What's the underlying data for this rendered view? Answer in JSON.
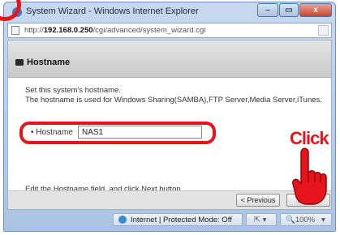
{
  "window": {
    "title": "System Wizard - Windows Internet Explorer",
    "title_icon": "ie-icon",
    "controls": {
      "minimize": "–",
      "maximize": "▭",
      "close": "x"
    }
  },
  "address_bar": {
    "url_prefix": "http://",
    "host": "192.168.0.250",
    "path": "/cgi/advanced/system_wizard.cgi"
  },
  "page": {
    "section_title": "Hostname",
    "description_line1": "Set this system's hostname.",
    "description_line2": "The hostname is used for Windows Sharing(SAMBA),FTP Server,Media Server,iTunes.",
    "field_label": "• Hostname",
    "hostname_value": "NAS1",
    "instruction": "Edit the Hostname field, and click Next button.",
    "prev_label": "< Previous",
    "next_label": "Next >"
  },
  "status_bar": {
    "zone": "Internet | Protected Mode: Off",
    "tool": "⇱ ▾",
    "zoom": "🔍100%",
    "zoom_arrow": "▾"
  },
  "annotation": {
    "click_label": "Click",
    "highlight_color": "#e8141b"
  }
}
